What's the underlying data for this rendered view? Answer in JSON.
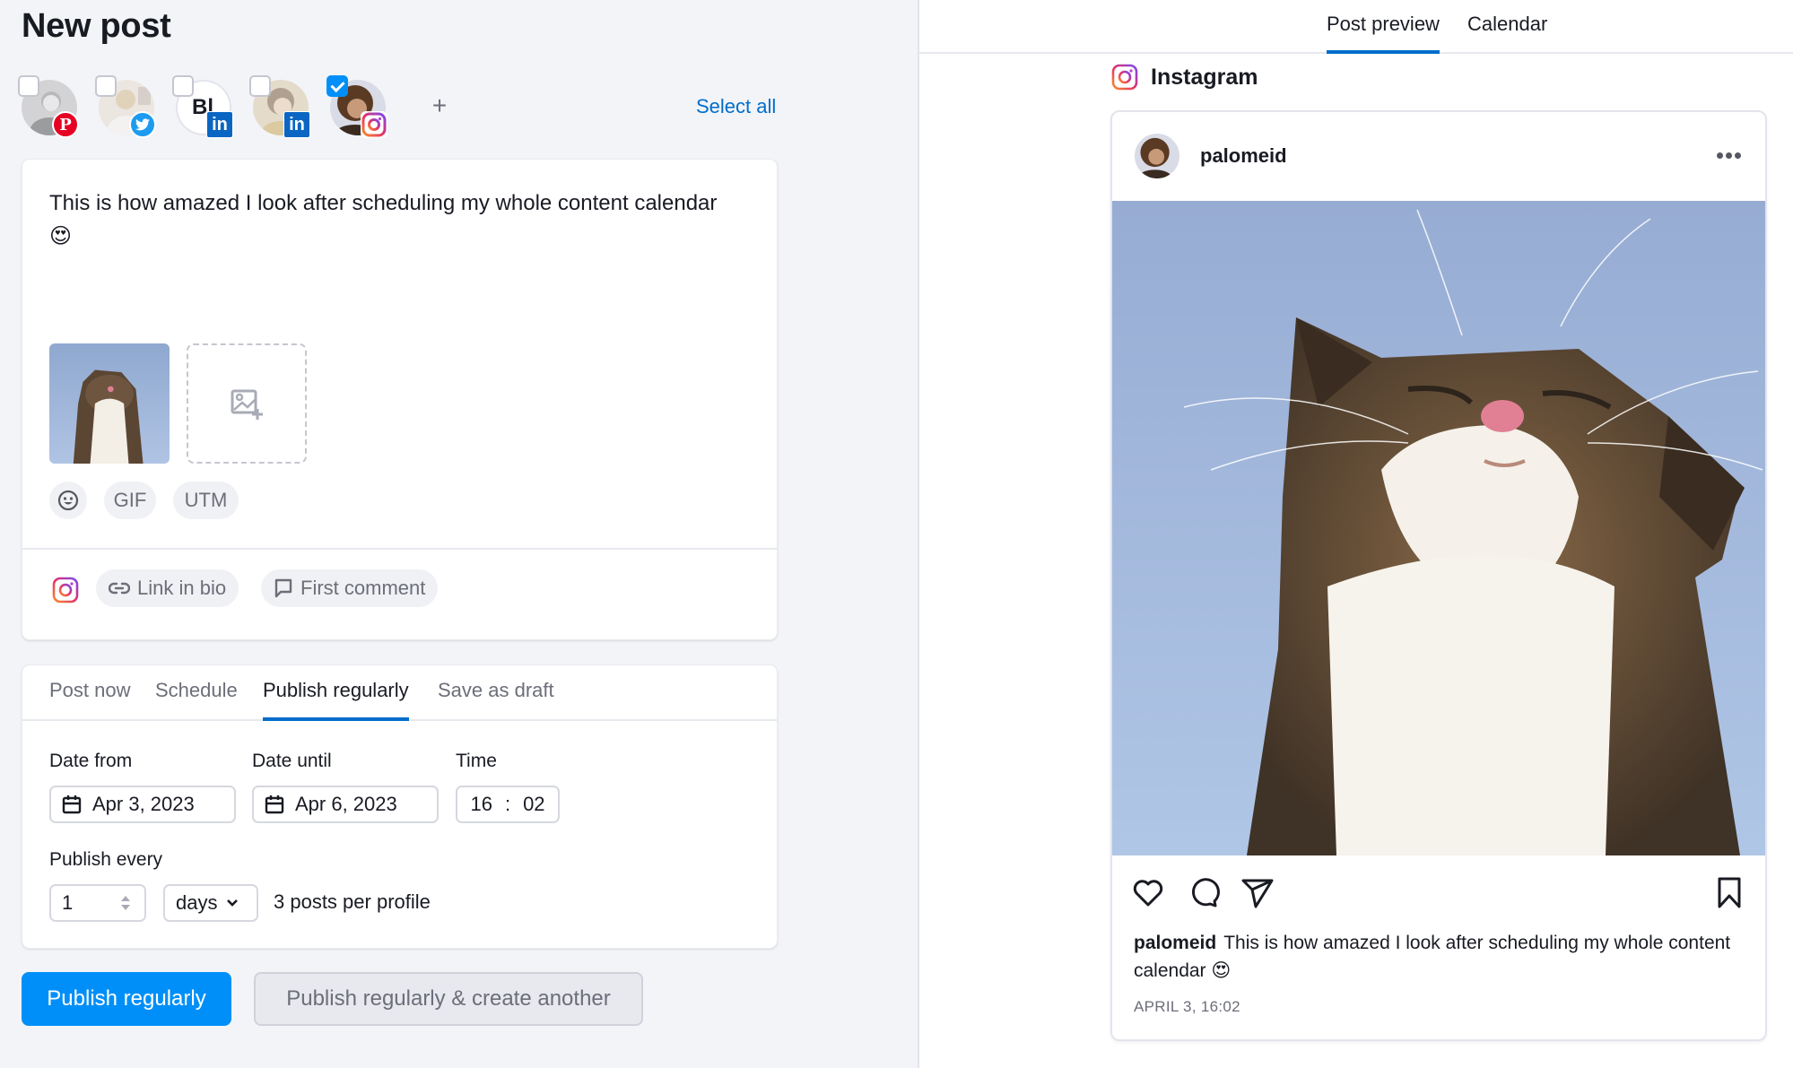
{
  "editor": {
    "title": "New post",
    "accounts": [
      {
        "network": "pinterest",
        "checked": false,
        "icon": "pinterest-icon"
      },
      {
        "network": "twitter",
        "checked": false,
        "icon": "twitter-icon"
      },
      {
        "network": "linkedin",
        "checked": false,
        "initials": "Bl",
        "icon": "linkedin-icon"
      },
      {
        "network": "linkedin",
        "checked": false,
        "icon": "linkedin-icon"
      },
      {
        "network": "instagram",
        "checked": true,
        "icon": "instagram-icon"
      }
    ],
    "add_account_label": "+",
    "select_all_label": "Select all",
    "post_text": "This is how amazed I look after scheduling my whole content calendar 😍",
    "toolbar": {
      "emoji_icon": "emoji-icon",
      "gif_label": "GIF",
      "utm_label": "UTM"
    },
    "instagram_options": {
      "link_in_bio_label": "Link in bio",
      "first_comment_label": "First comment"
    }
  },
  "publishing": {
    "tabs": [
      {
        "label": "Post now",
        "active": false
      },
      {
        "label": "Schedule",
        "active": false
      },
      {
        "label": "Publish regularly",
        "active": true
      },
      {
        "label": "Save as draft",
        "active": false
      }
    ],
    "date_from_label": "Date from",
    "date_from_value": "Apr 3, 2023",
    "date_until_label": "Date until",
    "date_until_value": "Apr 6, 2023",
    "time_label": "Time",
    "time_hours": "16",
    "time_separator": ":",
    "time_minutes": "02",
    "publish_every_label": "Publish every",
    "interval_value": "1",
    "interval_unit": "days",
    "posts_per_profile": "3 posts per profile"
  },
  "actions": {
    "primary_label": "Publish regularly",
    "secondary_label": "Publish regularly & create another"
  },
  "preview": {
    "tabs": [
      {
        "label": "Post preview",
        "active": true
      },
      {
        "label": "Calendar",
        "active": false
      }
    ],
    "network_label": "Instagram",
    "username": "palomeid",
    "caption": "This is how amazed I look after scheduling my whole content calendar 😍",
    "date": "APRIL 3, 16:02"
  },
  "colors": {
    "accent": "#006dca",
    "primary_button": "#008ff8",
    "page_bg": "#f3f4f8"
  }
}
